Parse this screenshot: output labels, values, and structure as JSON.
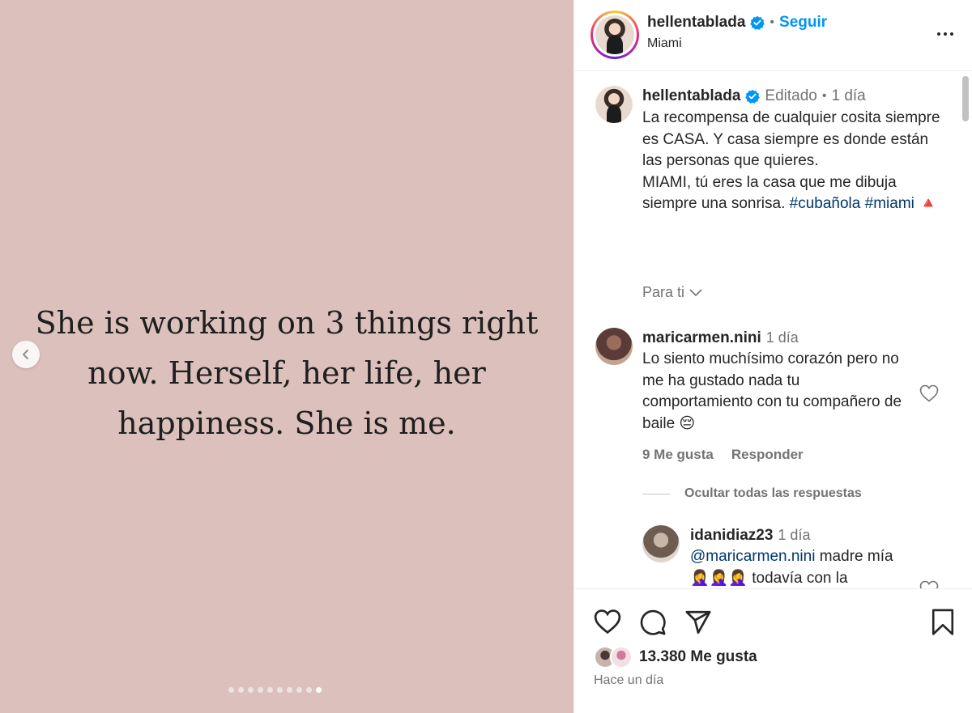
{
  "media": {
    "quote": "She is working on 3 things right now. Herself, her life, her happiness. She is me.",
    "dot_count": 10,
    "active_dot": 9
  },
  "header": {
    "username": "hellentablada",
    "separator": "•",
    "follow_label": "Seguir",
    "location": "Miami"
  },
  "caption": {
    "username": "hellentablada",
    "edited": "Editado",
    "separator": "•",
    "time": "1 día",
    "text": "La recompensa de cualquier cosita siempre es CASA. Y casa siempre es donde están las personas que quieres.",
    "text2": "MIAMI, tú eres la casa que me dibuja siempre una sonrisa.",
    "tag1": "#cubañola",
    "tag2": "#miami",
    "emoji": "🔺"
  },
  "for_you": "Para ti",
  "comments": [
    {
      "username": "maricarmen.nini",
      "time": "1 día",
      "text": "Lo siento muchísimo corazón pero no me ha gustado nada tu comportamiento con tu compañero de baile 😔",
      "likes": "9 Me gusta",
      "reply": "Responder"
    }
  ],
  "hide_replies": "Ocultar todas las respuestas",
  "reply": {
    "username": "idanidiaz23",
    "time": "1 día",
    "mention": "@maricarmen.nini",
    "text": " madre mía🤦‍♀️🤦‍♀️🤦‍♀️ todavía con la"
  },
  "footer": {
    "likes": "13.380 Me gusta",
    "posted": "Hace un día"
  },
  "colors": {
    "media_bg": "#dcc0bc",
    "accent": "#0095f6",
    "link": "#00376b",
    "secondary": "#737373"
  }
}
